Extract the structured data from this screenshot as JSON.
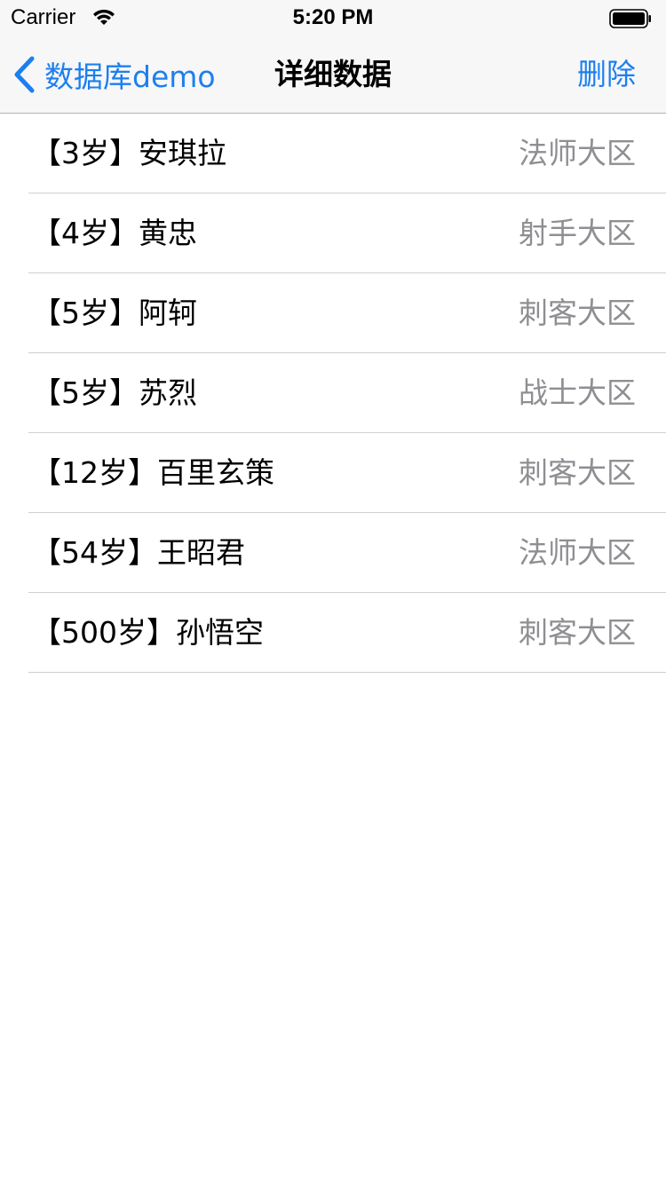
{
  "status_bar": {
    "carrier": "Carrier",
    "time": "5:20 PM",
    "wifi_icon": "wifi-icon",
    "battery_icon": "battery-icon"
  },
  "nav": {
    "back_label": "数据库demo",
    "back_icon": "chevron-left-icon",
    "title": "详细数据",
    "delete_label": "删除"
  },
  "colors": {
    "accent": "#1c7ff0",
    "detail_text": "#8e8e93",
    "separator": "#cfcfd3",
    "bar_background": "#f7f7f7"
  },
  "rows": [
    {
      "title": "【3岁】安琪拉",
      "detail": "法师大区"
    },
    {
      "title": "【4岁】黄忠",
      "detail": "射手大区"
    },
    {
      "title": "【5岁】阿轲",
      "detail": "刺客大区"
    },
    {
      "title": "【5岁】苏烈",
      "detail": "战士大区"
    },
    {
      "title": "【12岁】百里玄策",
      "detail": "刺客大区"
    },
    {
      "title": "【54岁】王昭君",
      "detail": "法师大区"
    },
    {
      "title": "【500岁】孙悟空",
      "detail": "刺客大区"
    }
  ]
}
